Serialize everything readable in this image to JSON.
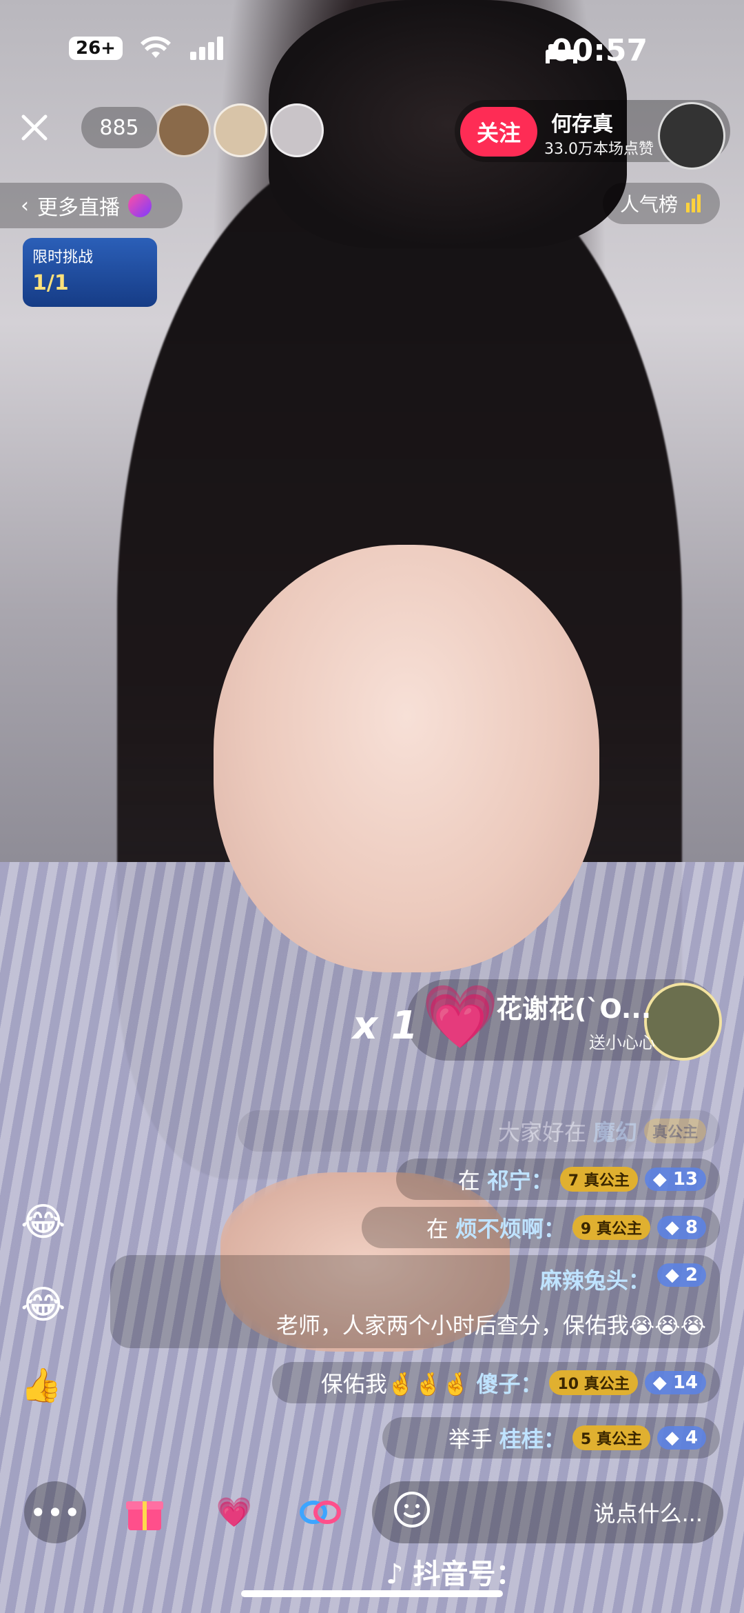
{
  "status": {
    "time": "00:57",
    "battery": "26+"
  },
  "header": {
    "viewer_count": "885",
    "host_name": "何存真",
    "host_subtitle": "33.0万本场点赞",
    "follow_label": "关注"
  },
  "pills": {
    "more_live": "更多直播",
    "rank": "人气榜"
  },
  "challenge": {
    "title": "限时挑战",
    "progress": "1/1"
  },
  "gift_banner": {
    "user": "花谢花(`O...",
    "action": "送小心心",
    "count": "x 1"
  },
  "comments": [
    {
      "level": "",
      "fan": "真公主",
      "user": "魔幻",
      "msg": "大家好在",
      "faded": true
    },
    {
      "level": "13",
      "fan": "真公主",
      "fan_level": "7",
      "user": "祁宁：",
      "msg": "在"
    },
    {
      "level": "8",
      "fan": "真公主",
      "fan_level": "9",
      "user": "烦不烦啊：",
      "msg": "在"
    },
    {
      "level": "2",
      "fan": "",
      "user": "麻辣兔头：",
      "msg": "老师，人家两个小时后查分，保佑我😭😭😭"
    },
    {
      "level": "14",
      "fan": "真公主",
      "fan_level": "10",
      "user": "傻子：",
      "msg": "保佑我🤞🤞🤞"
    },
    {
      "level": "4",
      "fan": "真公主",
      "fan_level": "5",
      "user": "桂桂：",
      "msg": "举手"
    }
  ],
  "bottom": {
    "input_placeholder": "说点什么...",
    "douyin_id": "抖音号："
  },
  "icons": {
    "close": "close-icon",
    "more": "more-icon",
    "gift": "gift-icon",
    "heart": "heart-icon",
    "link": "link-icon",
    "emoji": "emoji-icon"
  }
}
